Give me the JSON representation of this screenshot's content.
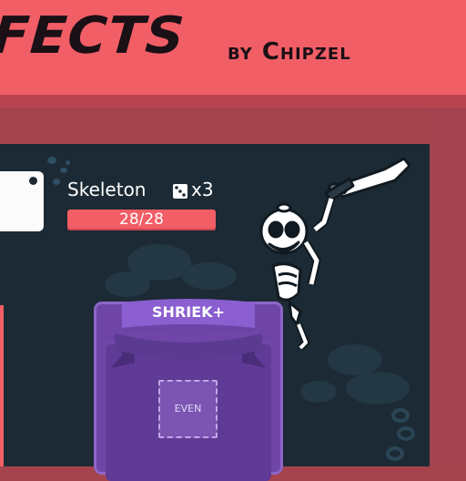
{
  "header": {
    "title": "FECTS",
    "byline": "by Chipzel"
  },
  "enemy": {
    "name": "Skeleton",
    "dice_icon": "dice-icon",
    "dice_count": "x3",
    "hp_text": "28/28",
    "hp_fraction": 1.0
  },
  "card": {
    "title": "SHRIEK+",
    "slot_label": "EVEN"
  },
  "colors": {
    "banner": "#f25e66",
    "frame": "#a6444e",
    "board": "#1b2a34",
    "card": "#6f45a8",
    "hp_bar": "#f25e66"
  }
}
